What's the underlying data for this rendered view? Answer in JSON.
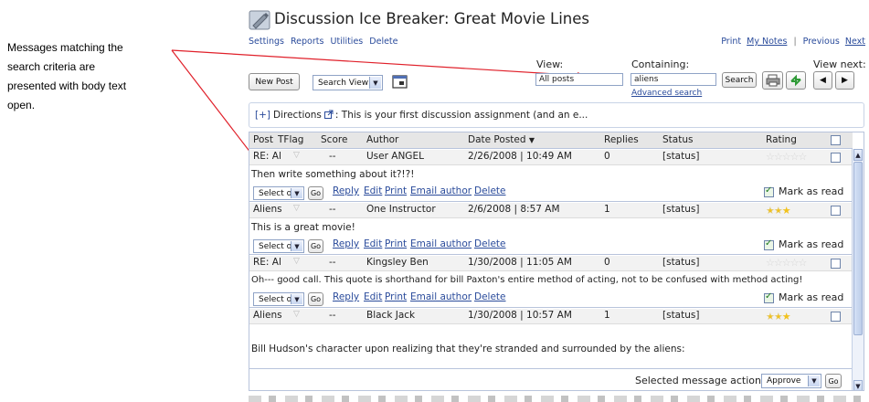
{
  "callout": {
    "line1": "Messages matching the",
    "line2": "search criteria are",
    "line3": "presented with body text",
    "line4": "open."
  },
  "header": {
    "title": "Discussion Ice Breaker: Great Movie Lines",
    "icon": "discussion-icon",
    "left_links": [
      "Settings",
      "Reports",
      "Utilities",
      "Delete"
    ],
    "right_links": [
      "Print",
      "My Notes",
      "Previous",
      "Next"
    ],
    "right_separator": "|"
  },
  "toolbar": {
    "new_post": "New Post",
    "view_select": "Search View",
    "view_label": "View:",
    "view_value": "All posts",
    "containing_label": "Containing:",
    "containing_value": "aliens",
    "search_button": "Search",
    "advanced_search": "Advanced search",
    "view_next_label": "View next:",
    "prev_arrow": "◀",
    "next_arrow": "▶"
  },
  "directions": {
    "toggle": "[+]",
    "label": "Directions",
    "text": ": This is your first discussion assignment (and an e..."
  },
  "table": {
    "columns": [
      "Post",
      "TFlag",
      "Score",
      "Author",
      "Date Posted",
      "Replies",
      "Status",
      "Rating"
    ],
    "rows": [
      {
        "post": "RE: Al",
        "score": "--",
        "author": "User ANGEL",
        "date": "2/26/2008 | 10:49 AM",
        "replies": "0",
        "status": "[status]",
        "rating": 0,
        "body": "Then write something about it?!?!"
      },
      {
        "post": "Aliens",
        "score": "--",
        "author": "One Instructor",
        "date": "2/6/2008 | 8:57 AM",
        "replies": "1",
        "status": "[status]",
        "rating": 3,
        "body": "This is a great movie!"
      },
      {
        "post": "RE: Al",
        "score": "--",
        "author": "Kingsley Ben",
        "date": "1/30/2008 | 11:05 AM",
        "replies": "0",
        "status": "[status]",
        "rating": 0,
        "body": "Oh--- good call. This quote is shorthand for bill Paxton's entire method of acting, not to be confused with method acting!"
      },
      {
        "post": "Aliens",
        "score": "--",
        "author": "Black Jack",
        "date": "1/30/2008 | 10:57 AM",
        "replies": "1",
        "status": "[status]",
        "rating": 3,
        "body": "Bill Hudson's character upon realizing that they're stranded and surrounded by the aliens:"
      }
    ],
    "action_select": "Select one",
    "go": "Go",
    "action_links": [
      "Reply",
      "Edit",
      "Print",
      "Email author",
      "Delete"
    ],
    "mark_as_read": "Mark as read"
  },
  "footer": {
    "label": "Selected message action:",
    "select_value": "Approve",
    "go": "Go"
  },
  "colors": {
    "link": "#2a4b9b",
    "annotation_arrow": "#e0202a",
    "star_filled": "#f2c21c"
  }
}
